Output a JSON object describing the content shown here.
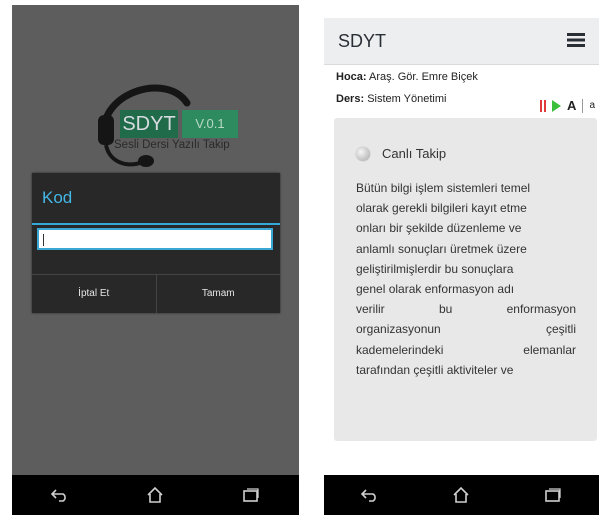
{
  "left_screen": {
    "logo": {
      "title": "SDYT",
      "version": "V.0.1",
      "subtitle": "Sesli Dersi Yazılı Takip"
    },
    "dialog": {
      "title": "Kod",
      "input_value": "",
      "cancel_label": "İptal Et",
      "ok_label": "Tamam"
    },
    "navbar": [
      "back-icon",
      "home-icon",
      "recents-icon"
    ]
  },
  "right_screen": {
    "app_title": "SDYT",
    "teacher_label": "Hoca:",
    "teacher_name": "Araş. Gör. Emre Biçek",
    "course_label": "Ders:",
    "course_name": "Sistem Yönetimi",
    "font_large_label": "A",
    "font_small_label": "a",
    "live_label": "Canlı Takip",
    "body_lines": [
      [
        "Bütün bilgi işlem sistemleri temel"
      ],
      [
        "olarak gerekli bilgileri kayıt etme"
      ],
      [
        "onları bir şekilde düzenleme ve"
      ],
      [
        "anlamlı sonuçları üretmek üzere"
      ],
      [
        "geliştirilmişlerdir bu sonuçlara"
      ],
      [
        "genel olarak enformasyon adı"
      ],
      [
        "verilir",
        "bu",
        "enformasyon"
      ],
      [
        "organizasyonun",
        "çeşitli"
      ],
      [
        "kademelerindeki",
        "elemanlar"
      ],
      [
        "tarafından çeşitli aktiviteler ve"
      ]
    ],
    "navbar": [
      "back-icon",
      "home-icon",
      "recents-icon"
    ]
  },
  "colors": {
    "accent_blue": "#43b7e6",
    "logo_green": "#1f6b4a",
    "pause_red": "#e03a3a",
    "play_green": "#3bbf3b"
  }
}
